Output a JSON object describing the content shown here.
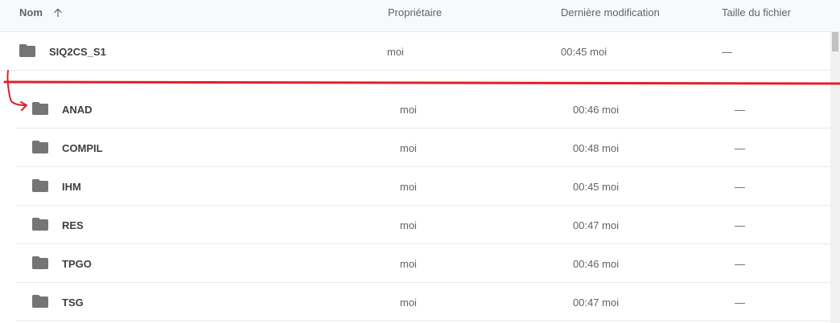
{
  "header": {
    "name_label": "Nom",
    "owner_label": "Propriétaire",
    "modified_label": "Dernière modification",
    "size_label": "Taille du fichier"
  },
  "parent": {
    "name": "SIQ2CS_S1",
    "owner": "moi",
    "modified": "00:45 moi",
    "size": "—"
  },
  "rows": [
    {
      "name": "ANAD",
      "owner": "moi",
      "modified": "00:46 moi",
      "size": "—"
    },
    {
      "name": "COMPIL",
      "owner": "moi",
      "modified": "00:48 moi",
      "size": "—"
    },
    {
      "name": "IHM",
      "owner": "moi",
      "modified": "00:45 moi",
      "size": "—"
    },
    {
      "name": "RES",
      "owner": "moi",
      "modified": "00:47 moi",
      "size": "—"
    },
    {
      "name": "TPGO",
      "owner": "moi",
      "modified": "00:46 moi",
      "size": "—"
    },
    {
      "name": "TSG",
      "owner": "moi",
      "modified": "00:47 moi",
      "size": "—"
    }
  ],
  "icons": {
    "folder": "folder-icon",
    "sort": "arrow-up-icon"
  },
  "colors": {
    "folder": "#757575",
    "annotation": "#e0202a"
  }
}
